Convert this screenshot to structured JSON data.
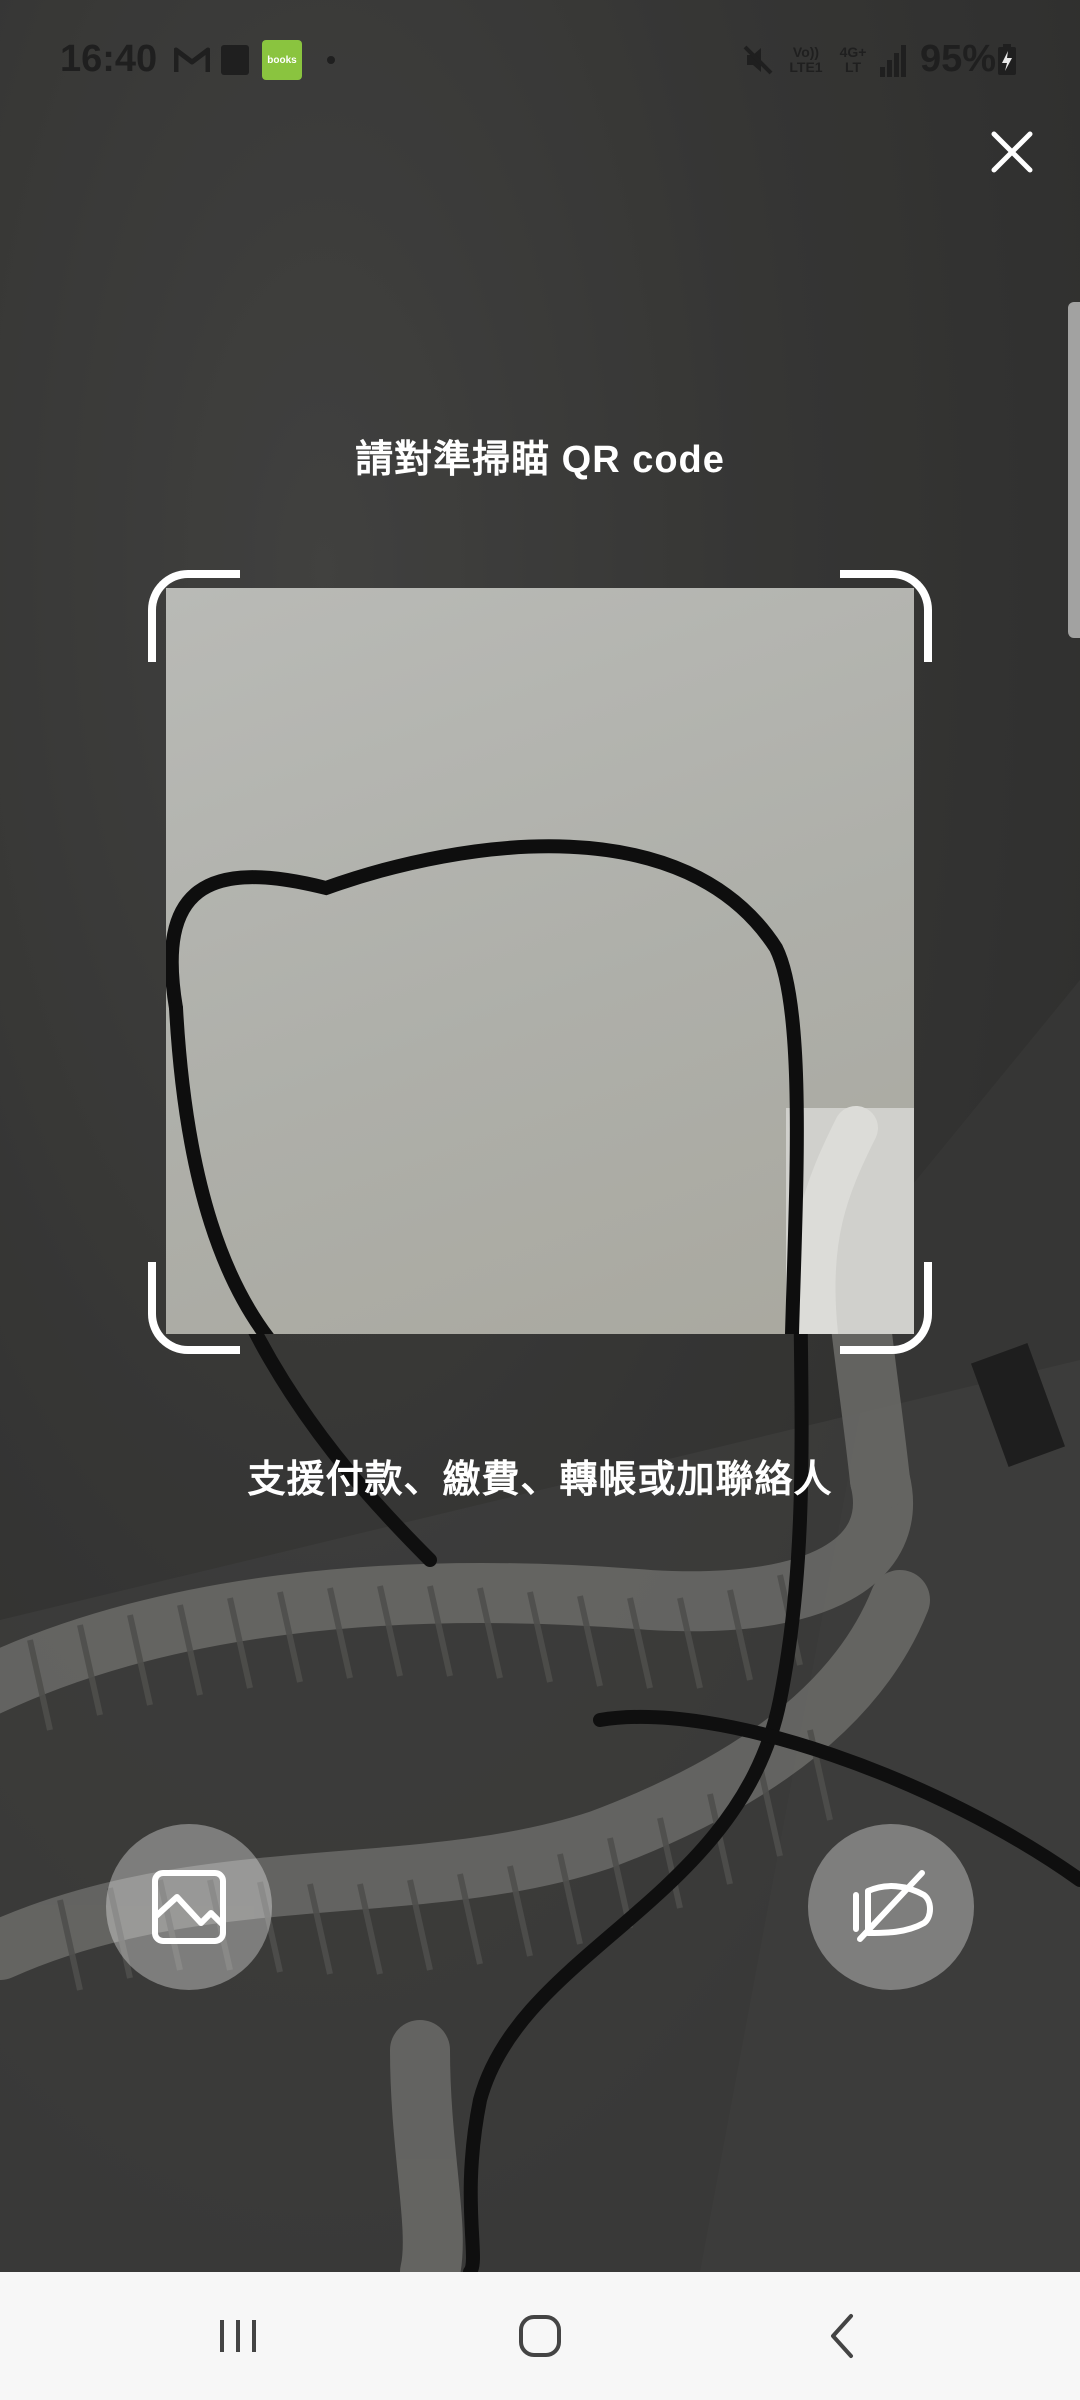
{
  "status_bar": {
    "time": "16:40",
    "battery_percent": "95%",
    "volte_top": "Vo))",
    "volte_bottom": "LTE1",
    "network_top": "4G+",
    "network_bottom": "LT",
    "books_app_label": "books",
    "icons": [
      "gmail-icon",
      "notification-app-icon",
      "books-app-icon",
      "dot-icon",
      "mute-icon",
      "volte-icon",
      "network-4g-icon",
      "signal-icon",
      "battery-charging-icon"
    ]
  },
  "scanner": {
    "title": "請對準掃瞄 QR code",
    "subtitle": "支援付款、繳費、轉帳或加聯絡人"
  },
  "buttons": {
    "close": "close-icon",
    "gallery": "image-gallery-icon",
    "flash": "flash-off-icon"
  },
  "nav_bar": {
    "recents": "recents-icon",
    "home": "home-icon",
    "back": "back-icon"
  },
  "colors": {
    "overlay_text": "#ffffff",
    "nav_bar_bg": "#f7f7f7",
    "books_green": "#8ac43f"
  }
}
